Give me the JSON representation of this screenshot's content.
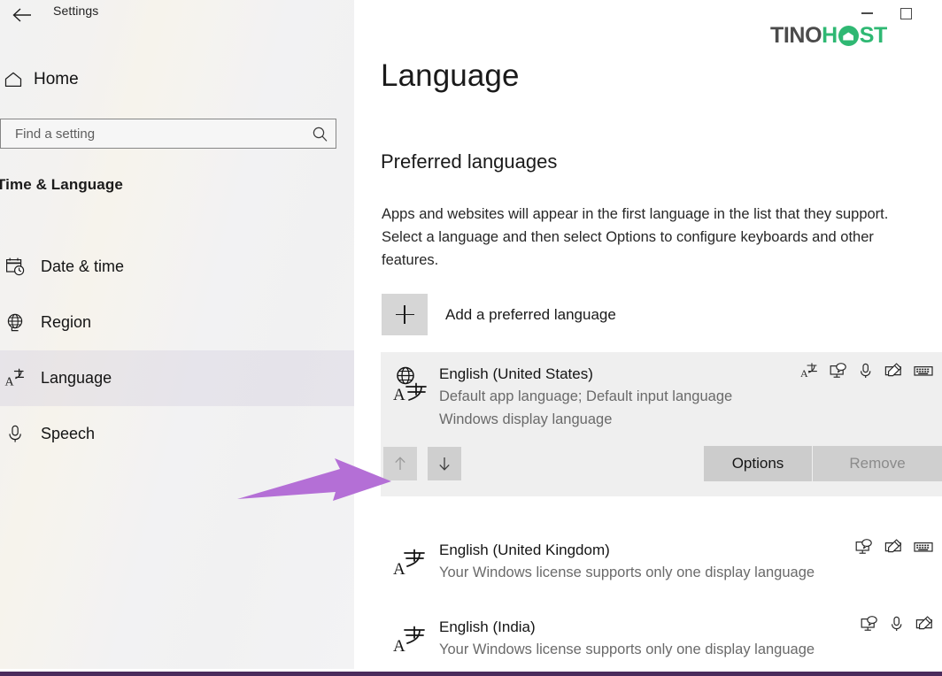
{
  "window": {
    "title": "Settings",
    "back_icon": "back-arrow-icon",
    "minimize_label": "—",
    "maximize_label": "□"
  },
  "brand": {
    "part1": "TINO",
    "part2": "H",
    "part3": "ST",
    "color_dark": "#4b4b4b",
    "color_green": "#2fb873"
  },
  "sidebar": {
    "home_label": "Home",
    "home_icon": "home-icon",
    "search": {
      "placeholder": "Find a setting",
      "value": "",
      "icon": "search-icon"
    },
    "section_title": "Time & Language",
    "items": [
      {
        "label": "Date & time",
        "icon": "calendar-clock-icon",
        "selected": false
      },
      {
        "label": "Region",
        "icon": "globe-icon",
        "selected": false
      },
      {
        "label": "Language",
        "icon": "language-icon",
        "selected": true
      },
      {
        "label": "Speech",
        "icon": "microphone-icon",
        "selected": false
      }
    ]
  },
  "main": {
    "page_title": "Language",
    "section_title": "Preferred languages",
    "description": "Apps and websites will appear in the first language in the list that they support. Select a language and then select Options to configure keyboards and other features.",
    "add_language": {
      "label": "Add a preferred language",
      "icon": "plus-icon"
    },
    "languages": [
      {
        "name": "English (United States)",
        "sub1": "Default app language; Default input language",
        "sub2": "Windows display language",
        "selected": true,
        "icons": [
          "translate-icon",
          "display-icon",
          "microphone-icon",
          "pen-icon",
          "keyboard-icon"
        ]
      },
      {
        "name": "English (United Kingdom)",
        "sub1": "Your Windows license supports only one display language",
        "sub2": "",
        "selected": false,
        "icons": [
          "display-icon",
          "pen-icon",
          "keyboard-icon"
        ]
      },
      {
        "name": "English (India)",
        "sub1": "Your Windows license supports only one display language",
        "sub2": "",
        "selected": false,
        "icons": [
          "display-icon",
          "microphone-icon",
          "pen-icon"
        ]
      }
    ],
    "card_actions": {
      "move_up_icon": "arrow-up-icon",
      "move_down_icon": "arrow-down-icon",
      "move_up_enabled": false,
      "move_down_enabled": true,
      "options_label": "Options",
      "remove_label": "Remove",
      "remove_enabled": false
    }
  },
  "annotation": {
    "arrow_color": "#b46fd6",
    "points_to": "move-up-button"
  }
}
